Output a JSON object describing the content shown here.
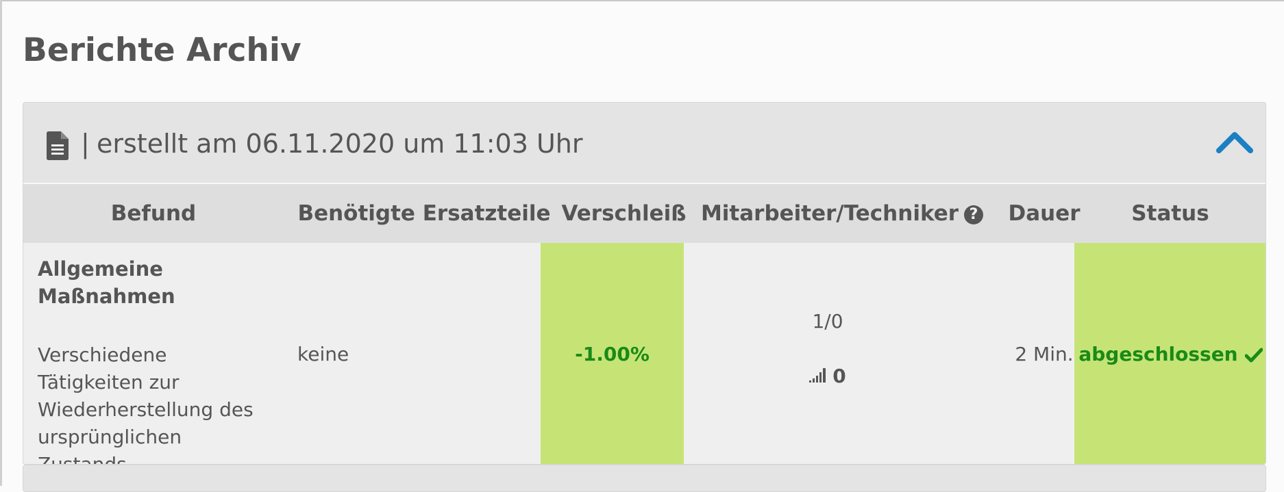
{
  "page": {
    "title": "Berichte Archiv"
  },
  "report": {
    "header_text": "erstellt am 06.11.2020 um 11:03 Uhr",
    "separator": "|",
    "icons": {
      "document": "document-icon",
      "collapse": "chevron-up-icon"
    },
    "accent_color": "#1b7fc4",
    "columns": {
      "befund": "Befund",
      "ersatzteile": "Benötigte Ersatzteile",
      "verschleiss": "Verschleiß",
      "mitarbeiter": "Mitarbeiter/Techniker",
      "dauer": "Dauer",
      "status": "Status"
    },
    "rows": [
      {
        "befund_title": "Allgemeine Maßnahmen",
        "befund_desc": "Verschiedene Tätigkeiten zur Wiederherstellung des ursprünglichen Zustands.",
        "ersatzteile": "keine",
        "verschleiss": "-1.00%",
        "mitarbeiter": "1/0",
        "level": "0",
        "dauer": "2 Min.",
        "status": "abgeschlossen"
      }
    ],
    "colors": {
      "highlight": "#c6e476",
      "success_text": "#1a8a18"
    }
  }
}
